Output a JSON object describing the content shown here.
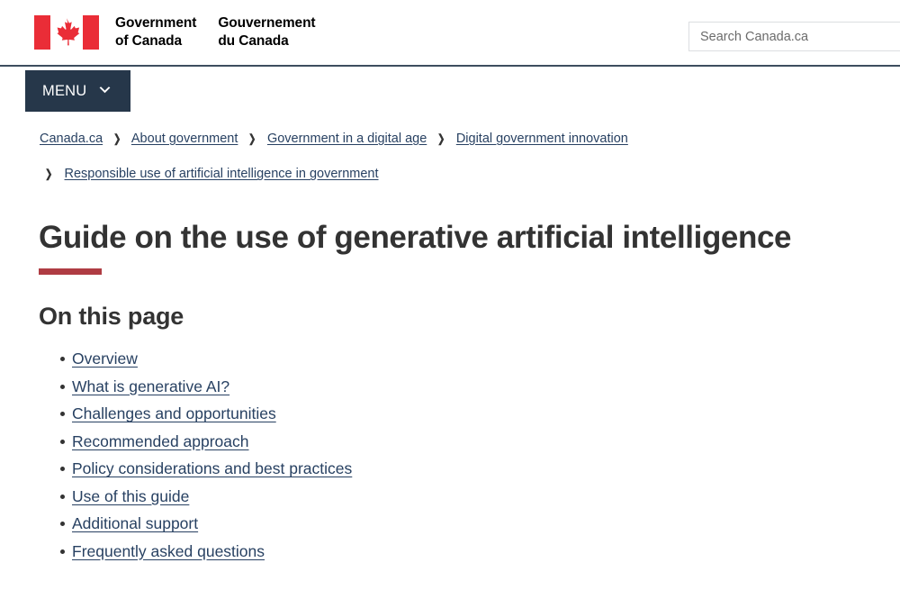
{
  "header": {
    "flag_icon": "canada-flag-icon",
    "wordmark_en_line1": "Government",
    "wordmark_en_line2": "of Canada",
    "wordmark_fr_line1": "Gouvernement",
    "wordmark_fr_line2": "du Canada",
    "search": {
      "placeholder": "Search Canada.ca",
      "value": ""
    }
  },
  "menu": {
    "label": "MENU",
    "chevron_icon": "chevron-down-icon"
  },
  "breadcrumb": {
    "separator_icon": "chevron-right-icon",
    "row1": [
      {
        "label": "Canada.ca"
      },
      {
        "label": "About government"
      },
      {
        "label": "Government in a digital age"
      },
      {
        "label": "Digital government innovation"
      }
    ],
    "row2": [
      {
        "label": "Responsible use of artificial intelligence in government"
      }
    ]
  },
  "main": {
    "page_title": "Guide on the use of generative artificial intelligence",
    "section_title": "On this page",
    "toc": [
      {
        "label": "Overview"
      },
      {
        "label": "What is generative AI?"
      },
      {
        "label": "Challenges and opportunities"
      },
      {
        "label": "Recommended approach"
      },
      {
        "label": "Policy considerations and best practices"
      },
      {
        "label": "Use of this guide"
      },
      {
        "label": "Additional support"
      },
      {
        "label": "Frequently asked questions"
      }
    ]
  },
  "colors": {
    "flag_red": "#EA2D37",
    "menu_navy": "#26374A",
    "rule_navy": "#3D4D5E",
    "title_underline_red": "#AF3C43",
    "link_blue": "#284162",
    "text": "#333333"
  }
}
